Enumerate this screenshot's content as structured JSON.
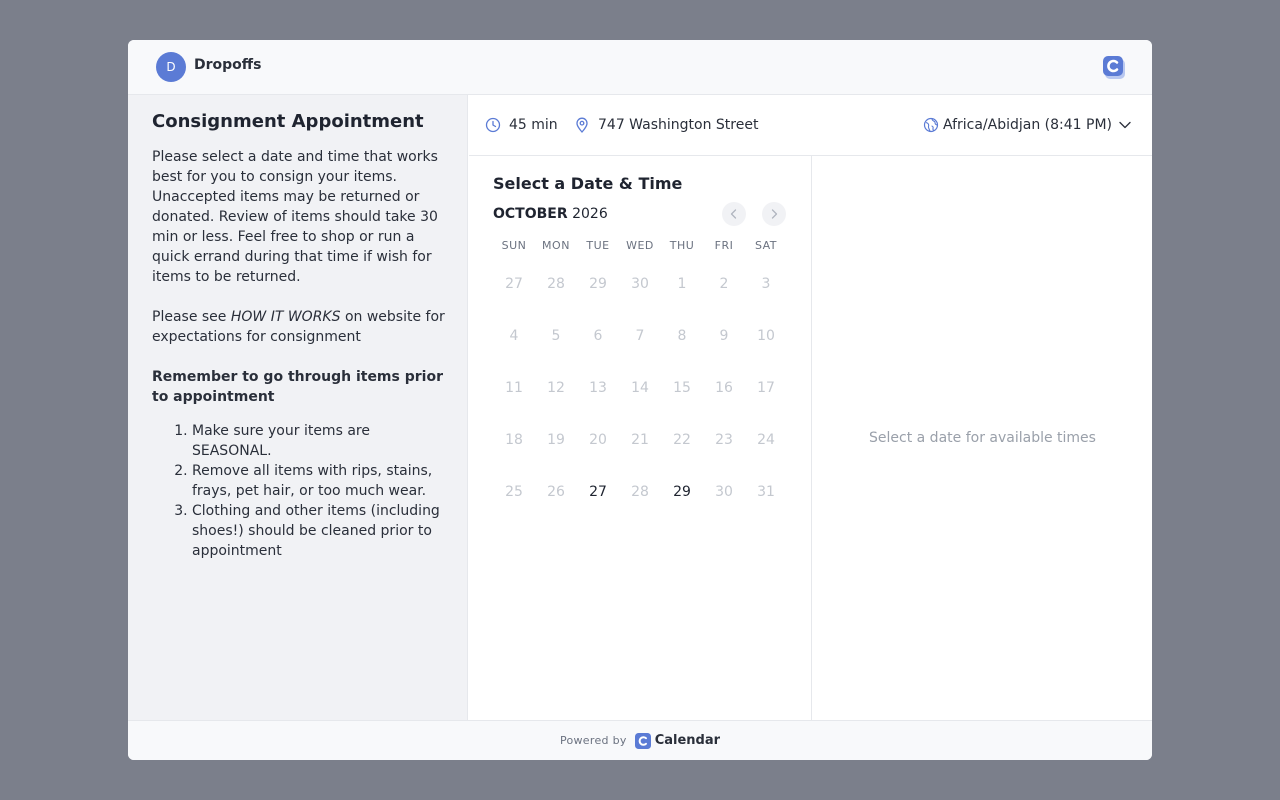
{
  "header": {
    "avatar_initial": "D",
    "org_name": "Dropoffs",
    "logo_icon": "calendar-c-logo-icon"
  },
  "event": {
    "title": "Consignment Appointment",
    "description_p1": "Please select a date and time that works best for you to consign your items. Unaccepted items may be returned or donated. Review of items should take 30 min or less. Feel free to shop or run a quick errand during that time if wish for items to be returned.",
    "description_p2_prefix": "Please see ",
    "description_p2_emphasis": "HOW IT WORKS",
    "description_p2_suffix": " on website for expectations for consignment",
    "reminder_heading": "Remember to go through items prior to appointment",
    "reminder_items": [
      "Make sure your items are SEASONAL.",
      "Remove all items with rips, stains, frays, pet hair, or too much wear.",
      "Clothing and other items (including shoes!) should be cleaned prior to appointment"
    ]
  },
  "info": {
    "duration": "45 min",
    "location": "747 Washington Street",
    "timezone": "Africa/Abidjan (8:41 PM)"
  },
  "calendar": {
    "heading": "Select a Date & Time",
    "month": "OCTOBER",
    "year": "2026",
    "weekdays": [
      "SUN",
      "MON",
      "TUE",
      "WED",
      "THU",
      "FRI",
      "SAT"
    ],
    "weeks": [
      [
        "27",
        "28",
        "29",
        "30",
        "1",
        "2",
        "3"
      ],
      [
        "4",
        "5",
        "6",
        "7",
        "8",
        "9",
        "10"
      ],
      [
        "11",
        "12",
        "13",
        "14",
        "15",
        "16",
        "17"
      ],
      [
        "18",
        "19",
        "20",
        "21",
        "22",
        "23",
        "24"
      ],
      [
        "25",
        "26",
        "27",
        "28",
        "29",
        "30",
        "31"
      ]
    ],
    "available_days": [
      "27",
      "29"
    ]
  },
  "times": {
    "empty_message": "Select a date for available times"
  },
  "footer": {
    "powered_by": "Powered by",
    "brand": "Calendar"
  },
  "colors": {
    "accent": "#5b7bd5",
    "backdrop": "#7b7f8b",
    "available_day": "#1f2430",
    "unavailable_day": "#c4c8cf"
  }
}
